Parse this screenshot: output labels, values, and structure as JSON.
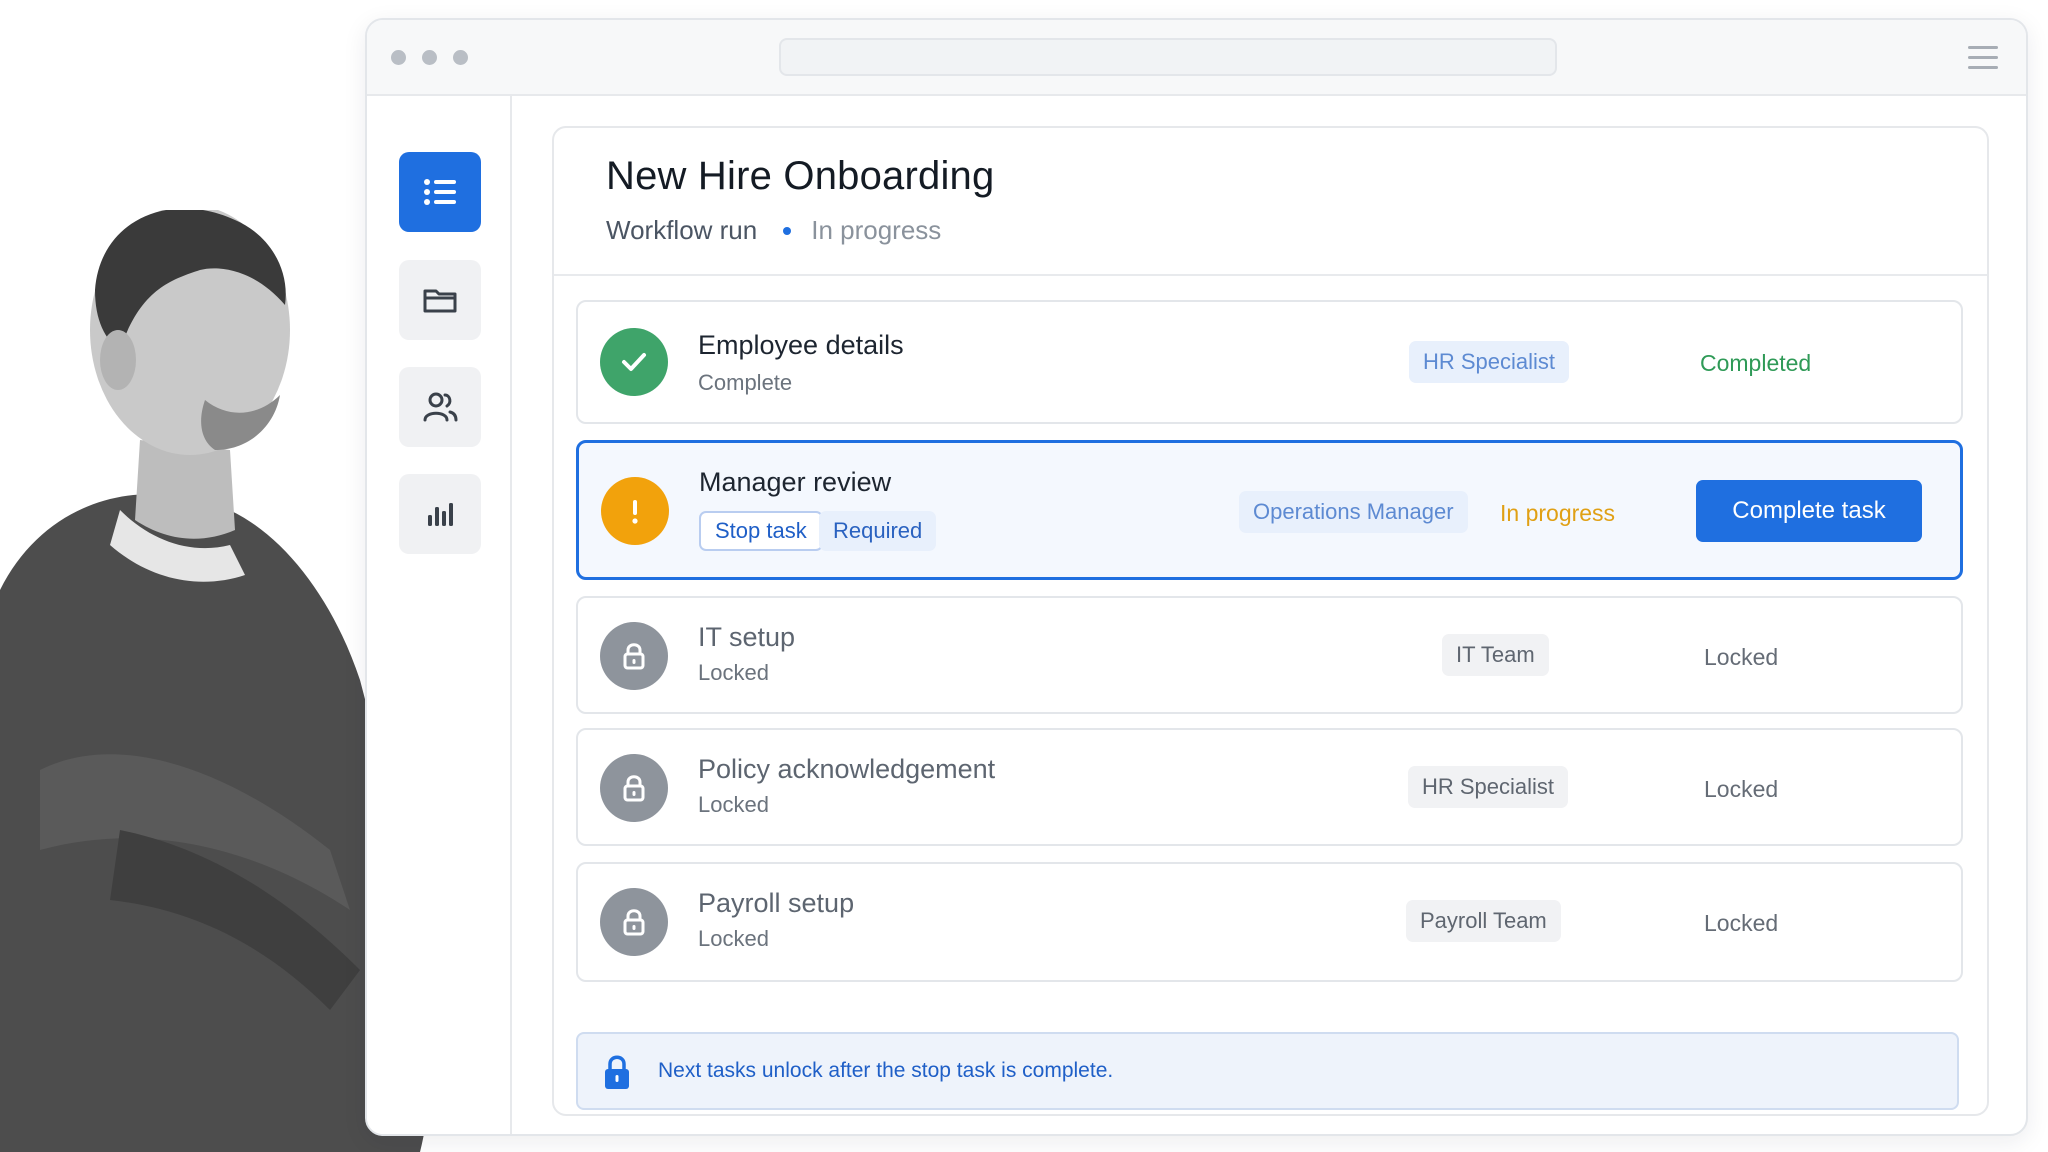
{
  "page": {
    "title": "New Hire Onboarding",
    "subtitle": "Workflow run",
    "status": "In progress"
  },
  "sidebar": {
    "items": [
      {
        "icon": "list-icon",
        "active": true
      },
      {
        "icon": "folder-icon",
        "active": false
      },
      {
        "icon": "users-icon",
        "active": false
      },
      {
        "icon": "bar-chart-icon",
        "active": false
      }
    ]
  },
  "tasks": [
    {
      "title": "Employee details",
      "sub": "Complete",
      "role": "HR Specialist",
      "status": "Completed",
      "state": "done"
    },
    {
      "title": "Manager review",
      "tag1": "Stop task",
      "tag2": "Required",
      "role": "Operations Manager",
      "status": "In progress",
      "action": "Complete task",
      "state": "active"
    },
    {
      "title": "IT setup",
      "sub": "Locked",
      "role": "IT Team",
      "status": "Locked",
      "state": "locked"
    },
    {
      "title": "Policy acknowledgement",
      "sub": "Locked",
      "role": "HR Specialist",
      "status": "Locked",
      "state": "locked"
    },
    {
      "title": "Payroll setup",
      "sub": "Locked",
      "role": "Payroll Team",
      "status": "Locked",
      "state": "locked"
    }
  ],
  "notice": {
    "text": "Next tasks unlock after the stop task is complete."
  },
  "colors": {
    "accent": "#1f6fe0",
    "success": "#3fa46a",
    "warning": "#f2a20c",
    "locked": "#8e949c"
  }
}
